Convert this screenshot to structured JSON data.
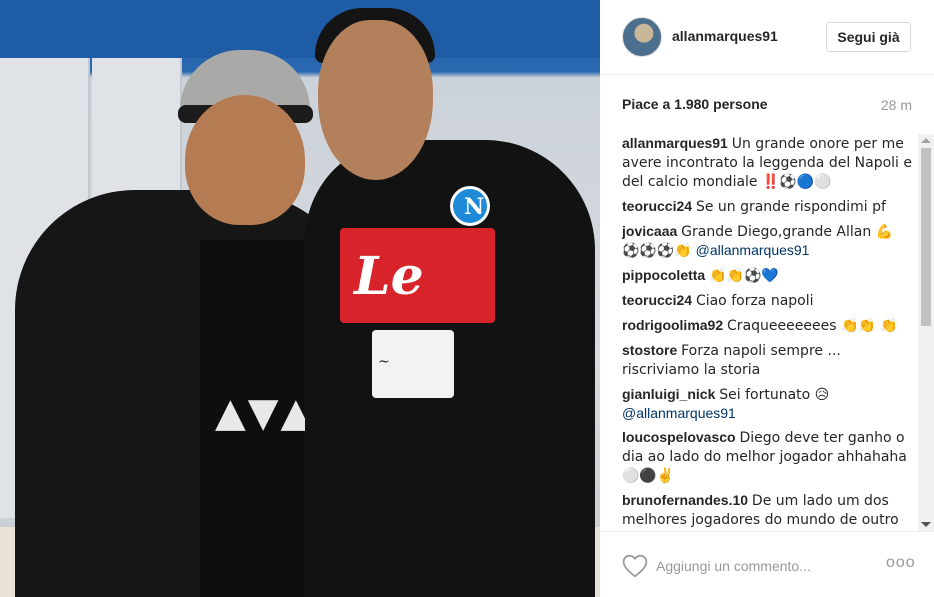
{
  "post": {
    "photo_alt": "",
    "username": "allanmarques91",
    "follow_label": "Segui già",
    "likes": "Piace a 1.980 persone",
    "time": "28 m"
  },
  "comments": [
    {
      "user": "allanmarques91",
      "text": "Un grande onore per me avere incontrato la leggenda del Napoli e del calcio mondiale ‼️⚽️🔵⚪️"
    },
    {
      "user": "teorucci24",
      "text": "Se un grande rispondimi pf"
    },
    {
      "user": "jovicaaa",
      "text": "Grande Diego,grande Allan 💪 ⚽️⚽️⚽️👏",
      "mention": "@allanmarques91"
    },
    {
      "user": "pippocoletta",
      "text": "👏👏⚽️💙"
    },
    {
      "user": "teorucci24",
      "text": "Ciao forza napoli"
    },
    {
      "user": "rodrigoolima92",
      "text": "Craqueeeeeees 👏👏 👏"
    },
    {
      "user": "stostore",
      "text": "Forza napoli sempre ... riscriviamo la storia"
    },
    {
      "user": "gianluigi_nick",
      "text": "Sei fortunato 😥",
      "mention": "@allanmarques91"
    },
    {
      "user": "loucospelovasco",
      "text": "Diego deve ter ganho o dia ao lado do melhor jogador ahhahaha ⚪️⚫️✌️"
    },
    {
      "user": "brunofernandes.10",
      "text": "De um lado um dos melhores jogadores do mundo de outro"
    }
  ],
  "footer": {
    "comment_placeholder": "Aggiungi un commento...",
    "more_label": "ooo"
  },
  "icons": {
    "heart": "heart-icon",
    "more": "more-options-icon",
    "scroll_up": "scroll-up-arrow-icon",
    "scroll_down": "scroll-down-arrow-icon"
  },
  "colors": {
    "mention": "#003569",
    "muted": "#999999",
    "border": "#dbdbdb"
  }
}
